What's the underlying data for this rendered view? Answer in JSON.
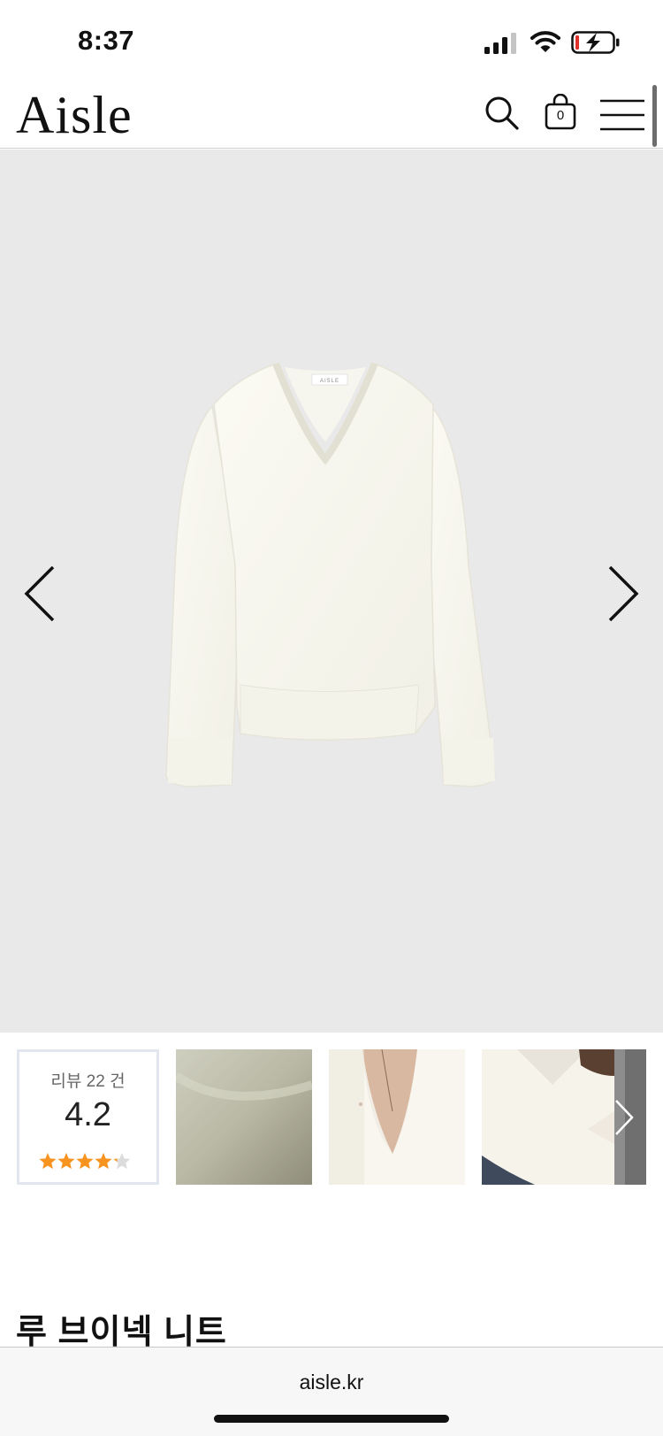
{
  "status_bar": {
    "time": "8:37"
  },
  "header": {
    "logo": "Aisle",
    "cart_count": "0",
    "icons": [
      "search-icon",
      "shopping-bag-icon",
      "hamburger-menu-icon"
    ]
  },
  "gallery": {
    "icons": [
      "chevron-left-icon",
      "chevron-right-icon"
    ],
    "background_color": "#e9e9e9"
  },
  "reviews": {
    "count_label": "리뷰 22 건",
    "score": "4.2",
    "rating": 4.2,
    "max_rating": 5,
    "star_color": "#f7931e"
  },
  "product": {
    "title": "루 브이넥 니트"
  },
  "browser": {
    "url": "aisle.kr"
  }
}
